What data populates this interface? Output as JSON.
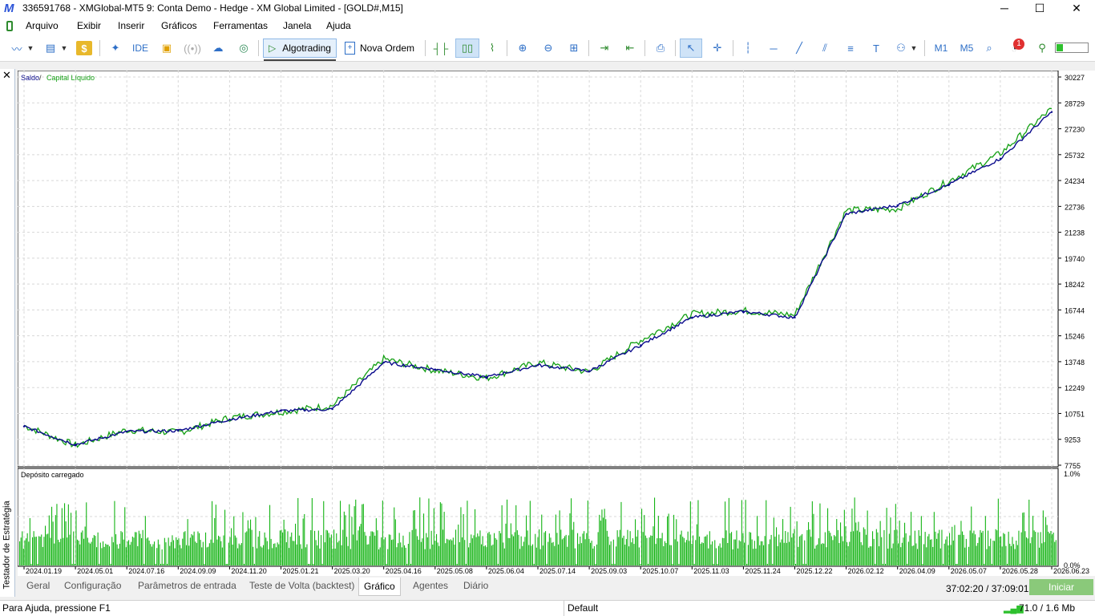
{
  "window": {
    "title": "336591768 - XMGlobal-MT5 9: Conta Demo - Hedge - XM Global Limited - [GOLD#,M15]",
    "minimize_glyph": "─",
    "maximize_glyph": "☐",
    "close_glyph": "✕"
  },
  "menu": [
    "Arquivo",
    "Exibir",
    "Inserir",
    "Gráficos",
    "Ferramentas",
    "Janela",
    "Ajuda"
  ],
  "toolbar": {
    "ide_label": "IDE",
    "algotrading_label": "Algotrading",
    "nova_ordem_label": "Nova Ordem",
    "m1_label": "M1",
    "m5_label": "M5",
    "notification_count": "1",
    "icons": [
      "line-chart-icon",
      "dropdown-icon",
      "chart-template-icon",
      "dollar-icon",
      "sparkle-icon",
      "bag-icon",
      "signal-icon",
      "cloud-icon",
      "vps-icon"
    ]
  },
  "side_panel": {
    "close_glyph": "✕",
    "title": "Testador de Estratégia"
  },
  "chart_data": [
    {
      "type": "line",
      "legend": [
        "Saldo",
        "Capital Líquido"
      ],
      "legend_separator": "/",
      "series": [
        {
          "name": "Saldo",
          "color": "#0a0a8c"
        },
        {
          "name": "Capital Líquido",
          "color": "#14a014"
        }
      ],
      "x_ticks": [
        "2024.01.19",
        "2024.05.01",
        "2024.07.16",
        "2024.09.09",
        "2024.11.20",
        "2025.01.21",
        "2025.03.20",
        "2025.04.16",
        "2025.05.08",
        "2025.06.04",
        "2025.07.14",
        "2025.09.03",
        "2025.10.07",
        "2025.11.03",
        "2025.11.24",
        "2025.12.22",
        "2026.02.12",
        "2026.04.09",
        "2026.05.07",
        "2026.05.28",
        "2026.06.23"
      ],
      "y_ticks": [
        30227,
        28729,
        27230,
        25732,
        24234,
        22736,
        21238,
        19740,
        18242,
        16744,
        15246,
        13748,
        12249,
        10751,
        9253,
        7755
      ],
      "ylim": [
        7755,
        30227
      ],
      "x": [
        "2024.01.19",
        "2024.05.01",
        "2024.07.16",
        "2024.09.09",
        "2024.11.20",
        "2025.01.21",
        "2025.03.20",
        "2025.04.16",
        "2025.05.08",
        "2025.06.04",
        "2025.07.14",
        "2025.09.03",
        "2025.10.07",
        "2025.11.03",
        "2025.11.24",
        "2025.12.22",
        "2026.02.12",
        "2026.04.09",
        "2026.05.07",
        "2026.05.28",
        "2026.06.23"
      ],
      "balance": [
        10000,
        8950,
        9700,
        9750,
        10400,
        10900,
        11000,
        13700,
        13300,
        12850,
        13550,
        13200,
        14700,
        16300,
        16650,
        16300,
        22300,
        22800,
        24000,
        25500,
        28200
      ],
      "equity": [
        10050,
        8900,
        9800,
        9650,
        10500,
        10850,
        11200,
        13900,
        13250,
        12800,
        13700,
        13150,
        15000,
        16500,
        16700,
        16450,
        22500,
        22600,
        24200,
        25800,
        28400
      ],
      "grid": true
    },
    {
      "type": "bar",
      "title": "Depósito carregado",
      "y_ticks": [
        "1.0%",
        "0.0%"
      ],
      "ylim": [
        0,
        1.0
      ],
      "color": "#14b414",
      "grid": true
    }
  ],
  "tabs": [
    "Geral",
    "Configuração",
    "Parâmetros de entrada",
    "Teste de Volta (backtest)",
    "Gráfico",
    "Agentes",
    "Diário"
  ],
  "active_tab": "Gráfico",
  "timer": "37:02:20 / 37:09:01",
  "start_button": "Iniciar",
  "status": {
    "help": "Para Ajuda, pressione F1",
    "profile": "Default",
    "connection": "71.0 / 1.6 Mb"
  }
}
